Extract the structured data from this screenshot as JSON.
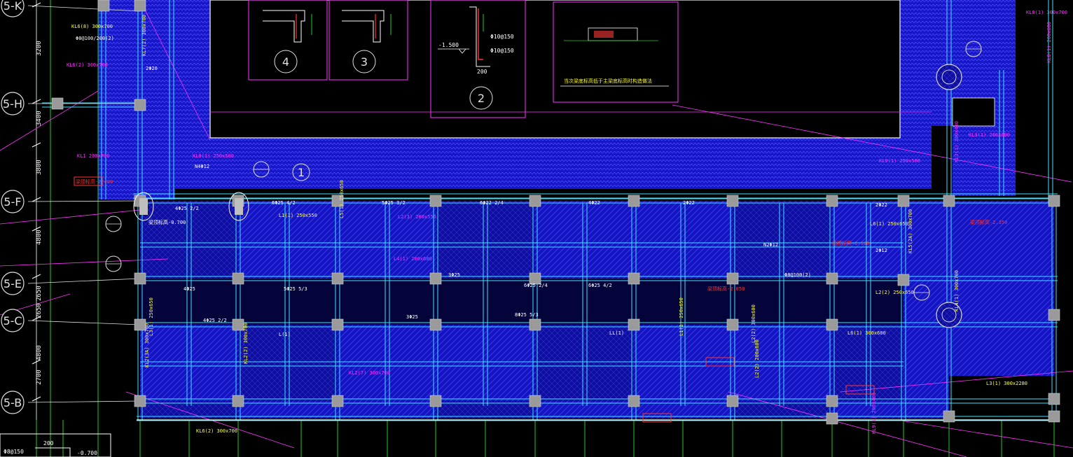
{
  "drawing": {
    "background": "#000000",
    "colors": {
      "slab_fill": "#1010c8",
      "beam_cyan": "#40e0ff",
      "grid_green": "#22cc22",
      "magenta": "#ff33ff",
      "yellow": "#ffff33",
      "white": "#ffffff",
      "red": "#ff3333",
      "column_gray": "#9a9a9a"
    },
    "grid_bubbles": [
      {
        "id": "5-K",
        "label": "5-K"
      },
      {
        "id": "5-H",
        "label": "5-H"
      },
      {
        "id": "5-F",
        "label": "5-F"
      },
      {
        "id": "5-E",
        "label": "5-E"
      },
      {
        "id": "5-C",
        "label": "5-C"
      },
      {
        "id": "5-B",
        "label": "5-B"
      }
    ],
    "row_dimensions": [
      "3200",
      "3400",
      "3800",
      "4800",
      "2650",
      "2650",
      "4800",
      "2700"
    ],
    "detail_markers": [
      {
        "id": "d4",
        "label": "4"
      },
      {
        "id": "d3",
        "label": "3"
      },
      {
        "id": "d2",
        "label": "2"
      },
      {
        "id": "d1",
        "label": "1"
      }
    ],
    "section_notes": {
      "elev_left": "-1.500",
      "dim_200": "200",
      "rebar_a": "Φ10@150",
      "rebar_b": "Φ10@150",
      "detail_caption": "当次梁底标高低于主梁底标高时构造做法"
    },
    "bottom_left": {
      "note1": "Φ8@150",
      "note2": "200",
      "elev": "-0.700"
    },
    "beam_labels": [
      {
        "text": "KL6(2) 300x700",
        "color": "magenta"
      },
      {
        "text": "KL6(8) 300x700",
        "color": "yellow"
      },
      {
        "text": "KL7(2) 300x700",
        "color": "yellow"
      },
      {
        "text": "KL1 200x700",
        "color": "magenta"
      },
      {
        "text": "KL8(1) 250x500",
        "color": "magenta"
      },
      {
        "text": "KL9(1) 250x500",
        "color": "magenta"
      },
      {
        "text": "L5(1) 250x650",
        "color": "yellow"
      },
      {
        "text": "L2(3) 200x550",
        "color": "magenta"
      },
      {
        "text": "L1(1) 250x550",
        "color": "yellow"
      },
      {
        "text": "L4(1) 200x600",
        "color": "magenta"
      },
      {
        "text": "KL3(1) 200x400",
        "color": "magenta"
      },
      {
        "text": "L6(1) 250x650",
        "color": "yellow"
      },
      {
        "text": "L3(1) 250x650",
        "color": "yellow"
      },
      {
        "text": "L2(2) 250x650",
        "color": "yellow"
      },
      {
        "text": "L1(1) 250x650",
        "color": "yellow"
      },
      {
        "text": "KL5(2A) 300x700",
        "color": "yellow"
      },
      {
        "text": "KL2(3A) 300x700",
        "color": "yellow"
      },
      {
        "text": "KL2(7) 300x700",
        "color": "magenta"
      },
      {
        "text": "KL2(2) 300x700",
        "color": "yellow"
      },
      {
        "text": "KL4(1) 300x700",
        "color": "yellow"
      },
      {
        "text": "L2(2) 300x600",
        "color": "yellow"
      },
      {
        "text": "L3(1) 300x2280",
        "color": "yellow"
      },
      {
        "text": "KL9(1) 200x400",
        "color": "magenta"
      },
      {
        "text": "KL3(1) 200x600",
        "color": "magenta"
      },
      {
        "text": "KL6(2) 300x700",
        "color": "yellow"
      },
      {
        "text": "L6(1) 300x600",
        "color": "yellow"
      },
      {
        "text": "L2(2) 200x600",
        "color": "yellow"
      },
      {
        "text": "KL8(1) 200x600",
        "color": "magenta"
      },
      {
        "text": "KL8(1) 300x700",
        "color": "magenta"
      }
    ],
    "rebar_labels": [
      "Φ8@100/200(2)",
      "2Φ20",
      "N4Φ12",
      "梁顶标高-0.700",
      "4Φ25 2/2",
      "6Φ25 4/2",
      "5Φ25 3/2",
      "6Φ22 2/4",
      "4Φ22",
      "2Φ22",
      "3Φ25",
      "6Φ25 2/4",
      "4Φ25",
      "5Φ25 5/3",
      "6Φ25 4/2",
      "Φ8@100(2)",
      "2Φ22",
      "梁顶标高-2.100",
      "梁顶标高-2.050",
      "梁顶标高-2.350",
      "梁顶标高-2.400",
      "LL(1)",
      "L(1)",
      "4Φ25 2/2",
      "8Φ25 5/3",
      "2Φ12",
      "N2Φ12",
      "3Φ25"
    ]
  }
}
